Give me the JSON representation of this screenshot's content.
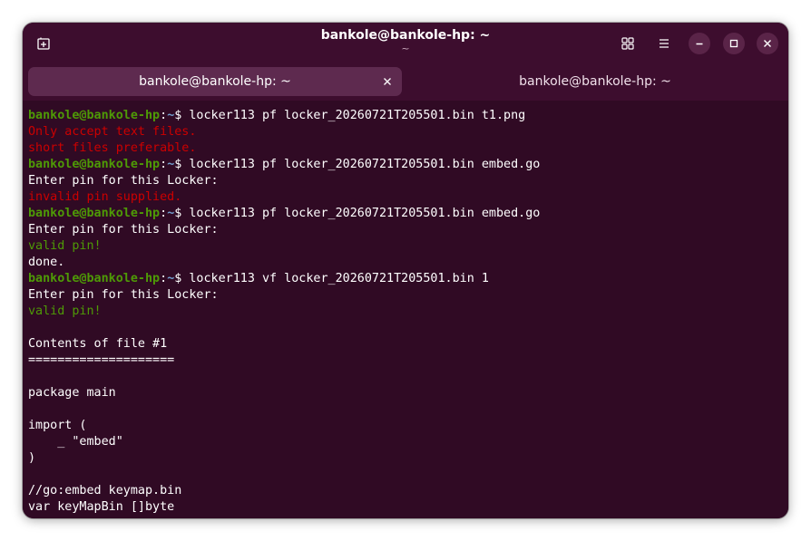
{
  "window": {
    "title": "bankole@bankole-hp: ~",
    "subtitle": "~"
  },
  "tabs": [
    {
      "label": "bankole@bankole-hp: ~",
      "active": true
    },
    {
      "label": "bankole@bankole-hp: ~",
      "active": false
    }
  ],
  "icons": {
    "new_tab": "new-tab-icon",
    "view": "grid-view-icon",
    "menu": "hamburger-menu-icon",
    "minimize": "minimize-icon",
    "maximize": "maximize-icon",
    "close": "close-icon",
    "tab_close": "close-icon"
  },
  "colors": {
    "background": "#300a24",
    "prompt_user": "#4e9a06",
    "prompt_path": "#729fcf",
    "error": "#cc0000",
    "success": "#4e9a06",
    "text": "#ffffff"
  },
  "terminal": {
    "lines": [
      {
        "type": "prompt",
        "user": "bankole@bankole-hp",
        "sep": ":",
        "path": "~",
        "sym": "$ ",
        "cmd": "locker113 pf locker_20260721T205501.bin t1.png"
      },
      {
        "type": "error",
        "text": "Only accept text files."
      },
      {
        "type": "error",
        "text": "short files preferable."
      },
      {
        "type": "prompt",
        "user": "bankole@bankole-hp",
        "sep": ":",
        "path": "~",
        "sym": "$ ",
        "cmd": "locker113 pf locker_20260721T205501.bin embed.go"
      },
      {
        "type": "text",
        "text": "Enter pin for this Locker:"
      },
      {
        "type": "error",
        "text": "invalid pin supplied."
      },
      {
        "type": "prompt",
        "user": "bankole@bankole-hp",
        "sep": ":",
        "path": "~",
        "sym": "$ ",
        "cmd": "locker113 pf locker_20260721T205501.bin embed.go"
      },
      {
        "type": "text",
        "text": "Enter pin for this Locker:"
      },
      {
        "type": "success",
        "text": "valid pin!"
      },
      {
        "type": "text",
        "text": "done."
      },
      {
        "type": "prompt",
        "user": "bankole@bankole-hp",
        "sep": ":",
        "path": "~",
        "sym": "$ ",
        "cmd": "locker113 vf locker_20260721T205501.bin 1"
      },
      {
        "type": "text",
        "text": "Enter pin for this Locker:"
      },
      {
        "type": "success",
        "text": "valid pin!"
      },
      {
        "type": "text",
        "text": ""
      },
      {
        "type": "text",
        "text": "Contents of file #1"
      },
      {
        "type": "text",
        "text": "===================="
      },
      {
        "type": "text",
        "text": ""
      },
      {
        "type": "text",
        "text": "package main"
      },
      {
        "type": "text",
        "text": ""
      },
      {
        "type": "text",
        "text": "import ("
      },
      {
        "type": "text",
        "text": "    _ \"embed\""
      },
      {
        "type": "text",
        "text": ")"
      },
      {
        "type": "text",
        "text": ""
      },
      {
        "type": "text",
        "text": "//go:embed keymap.bin"
      },
      {
        "type": "text",
        "text": "var keyMapBin []byte"
      }
    ]
  }
}
